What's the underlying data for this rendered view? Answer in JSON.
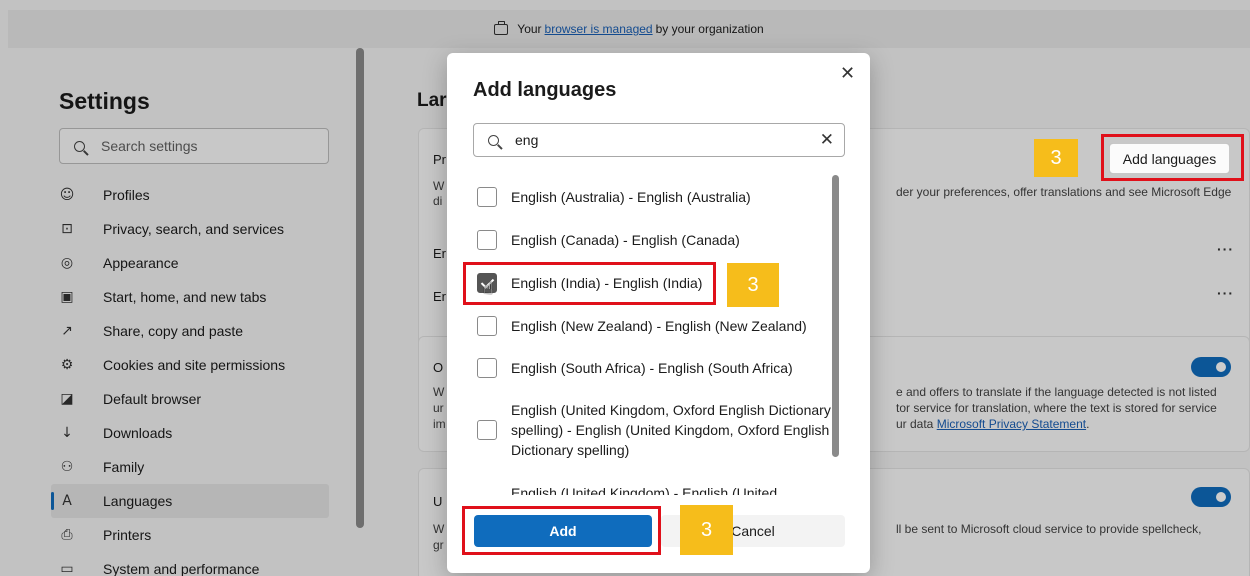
{
  "banner": {
    "prefix": "Your",
    "link": "browser is managed",
    "suffix": "by your organization"
  },
  "sidebar": {
    "title": "Settings",
    "search_placeholder": "Search settings",
    "items": [
      {
        "label": "Profiles",
        "icon": "profile-icon"
      },
      {
        "label": "Privacy, search, and services",
        "icon": "lock-icon"
      },
      {
        "label": "Appearance",
        "icon": "appearance-icon"
      },
      {
        "label": "Start, home, and new tabs",
        "icon": "home-tabs-icon"
      },
      {
        "label": "Share, copy and paste",
        "icon": "share-icon"
      },
      {
        "label": "Cookies and site permissions",
        "icon": "cookies-icon"
      },
      {
        "label": "Default browser",
        "icon": "default-browser-icon"
      },
      {
        "label": "Downloads",
        "icon": "download-icon"
      },
      {
        "label": "Family",
        "icon": "family-icon"
      },
      {
        "label": "Languages",
        "icon": "languages-icon",
        "active": true
      },
      {
        "label": "Printers",
        "icon": "printer-icon"
      },
      {
        "label": "System and performance",
        "icon": "laptop-icon"
      }
    ]
  },
  "main": {
    "title_fragment": "Lar",
    "card1": {
      "heading_fragment": "Pr",
      "desc_left_1": "W",
      "desc_left_2": "di",
      "desc_right": "der your preferences, offer translations and see Microsoft Edge",
      "row1_fragment": "Er",
      "row2_fragment": "Er",
      "row_menu": "···",
      "add_button": "Add languages"
    },
    "card2": {
      "heading_fragment": "O",
      "left_1": "W",
      "left_2": "ur",
      "left_3": "im",
      "right_1": "e and offers to translate if the language detected is not listed",
      "right_2": "tor service for translation, where the text is stored for service",
      "right_3_prefix": "ur data",
      "right_3_link": "Microsoft Privacy Statement",
      "right_3_suffix": "."
    },
    "card3": {
      "heading_fragment": "U",
      "left_1": "W",
      "left_2": "gr",
      "right_1": "ll be sent to Microsoft cloud service to provide spellcheck,"
    }
  },
  "dialog": {
    "title": "Add languages",
    "close_glyph": "✕",
    "search_value": "eng",
    "clear_glyph": "✕",
    "options": [
      {
        "label": "English (Australia) - English (Australia)",
        "checked": false
      },
      {
        "label": "English (Canada) - English (Canada)",
        "checked": false
      },
      {
        "label": "English (India) - English (India)",
        "checked": true
      },
      {
        "label": "English (New Zealand) - English (New Zealand)",
        "checked": false
      },
      {
        "label": "English (South Africa) - English (South Africa)",
        "checked": false
      },
      {
        "label": "English (United Kingdom, Oxford English Dictionary spelling) - English (United Kingdom, Oxford English Dictionary spelling)",
        "checked": false
      },
      {
        "label": "English (United Kingdom) - English (United",
        "checked": false
      }
    ],
    "add_label": "Add",
    "cancel_label": "Cancel"
  },
  "annotations": {
    "step_number": "3",
    "highlight_color": "#e0101a",
    "badge_color": "#f6bd1b"
  },
  "colors": {
    "accent": "#0f6cbd",
    "link": "#1a5fb4"
  }
}
